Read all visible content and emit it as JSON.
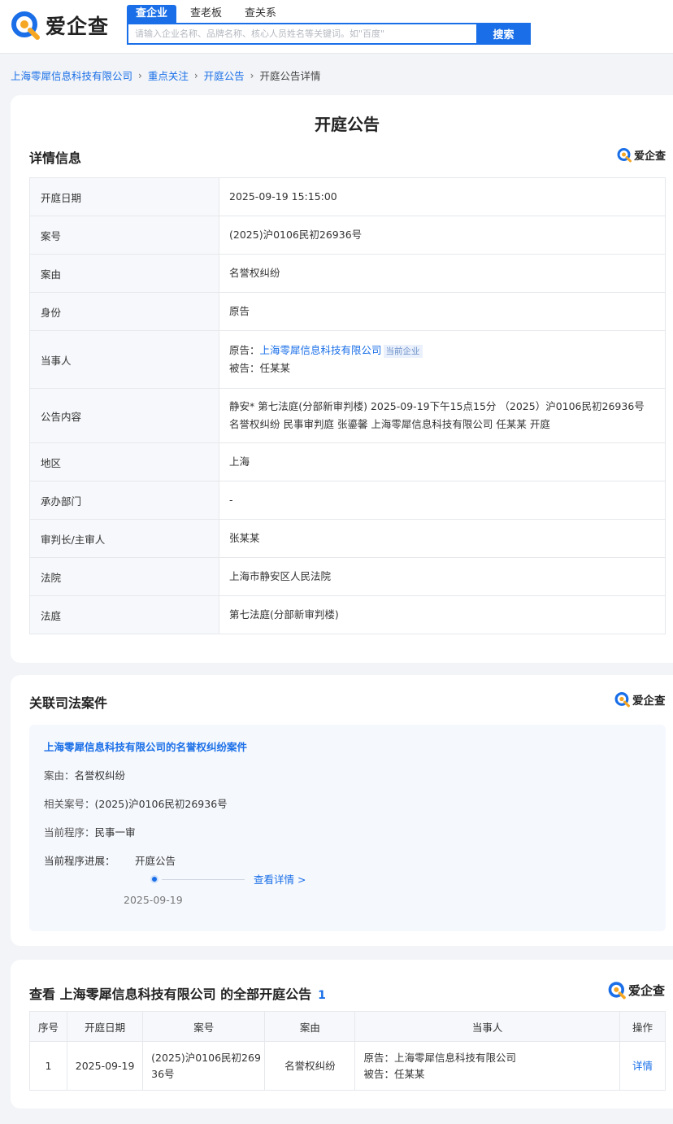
{
  "header": {
    "logo_text": "爱企查",
    "tabs": [
      {
        "label": "查企业",
        "active": true
      },
      {
        "label": "查老板",
        "active": false
      },
      {
        "label": "查关系",
        "active": false
      }
    ],
    "search_placeholder": "请输入企业名称、品牌名称、核心人员姓名等关键词。如\"百度\"",
    "search_button": "搜索"
  },
  "breadcrumb": {
    "items": [
      "上海零犀信息科技有限公司",
      "重点关注",
      "开庭公告"
    ],
    "current": "开庭公告详情"
  },
  "detail": {
    "page_title": "开庭公告",
    "section_title": "详情信息",
    "brand": "爱企查",
    "rows": {
      "date_label": "开庭日期",
      "date_value": "2025-09-19 15:15:00",
      "case_no_label": "案号",
      "case_no_value": "(2025)沪0106民初26936号",
      "cause_label": "案由",
      "cause_value": "名誉权纠纷",
      "identity_label": "身份",
      "identity_value": "原告",
      "party_label": "当事人",
      "plaintiff_prefix": "原告：",
      "plaintiff_name": "上海零犀信息科技有限公司",
      "current_tag": "当前企业",
      "defendant_prefix": "被告：",
      "defendant_name": "任某某",
      "content_label": "公告内容",
      "content_value": "静安* 第七法庭(分部新审判楼) 2025-09-19下午15点15分 （2025）沪0106民初26936号 名誉权纠纷 民事审判庭 张鎏馨 上海零犀信息科技有限公司 任某某 开庭",
      "region_label": "地区",
      "region_value": "上海",
      "dept_label": "承办部门",
      "dept_value": "-",
      "judge_label": "审判长/主审人",
      "judge_value": "张某某",
      "court_label": "法院",
      "court_value": "上海市静安区人民法院",
      "room_label": "法庭",
      "room_value": "第七法庭(分部新审判楼)"
    }
  },
  "related": {
    "section_title": "关联司法案件",
    "brand": "爱企查",
    "case_title": "上海零犀信息科技有限公司的名誉权纠纷案件",
    "cause_label": "案由：",
    "cause_value": "名誉权纠纷",
    "case_no_label": "相关案号：",
    "case_no_value": "(2025)沪0106民初26936号",
    "procedure_label": "当前程序：",
    "procedure_value": "民事一审",
    "progress_label": "当前程序进展：",
    "progress_step": "开庭公告",
    "progress_link": "查看详情 >",
    "progress_date": "2025-09-19"
  },
  "list": {
    "title_prefix": "查看 上海零犀信息科技有限公司 的全部开庭公告",
    "count": "1",
    "brand": "爱企查",
    "columns": [
      "序号",
      "开庭日期",
      "案号",
      "案由",
      "当事人",
      "操作"
    ],
    "rows": [
      {
        "index": "1",
        "date": "2025-09-19",
        "case_no_1": "(2025)沪0106民初269",
        "case_no_2": "36号",
        "cause": "名誉权纠纷",
        "plaintiff": "原告：上海零犀信息科技有限公司",
        "defendant": "被告：任某某",
        "action": "详情"
      }
    ]
  },
  "colors": {
    "accent": "#1a6fe8",
    "logo_orange": "#f5a623",
    "logo_blue": "#1a6fe8"
  }
}
